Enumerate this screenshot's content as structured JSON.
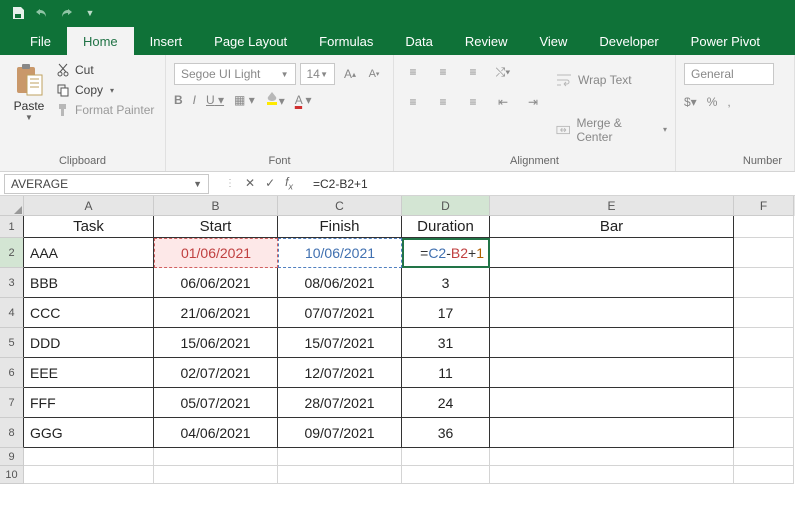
{
  "qat": {
    "save": "save",
    "undo": "undo",
    "redo": "redo"
  },
  "tabs": [
    "File",
    "Home",
    "Insert",
    "Page Layout",
    "Formulas",
    "Data",
    "Review",
    "View",
    "Developer",
    "Power Pivot"
  ],
  "active_tab": 1,
  "clipboard": {
    "paste": "Paste",
    "cut": "Cut",
    "copy": "Copy",
    "format_painter": "Format Painter",
    "label": "Clipboard"
  },
  "font": {
    "name": "Segoe UI Light",
    "size": "14",
    "label": "Font",
    "bold": "B",
    "italic": "I",
    "underline": "U"
  },
  "alignment": {
    "wrap": "Wrap Text",
    "merge": "Merge & Center",
    "label": "Alignment"
  },
  "number": {
    "format": "General",
    "label": "Number"
  },
  "namebox": "AVERAGE",
  "formula": "=C2-B2+1",
  "formula_tokens": {
    "eq": "=",
    "c2": "C2",
    "minus": "-",
    "b2": "B2",
    "plus": "+",
    "one": "1"
  },
  "columns": [
    "A",
    "B",
    "C",
    "D",
    "E",
    "F"
  ],
  "headers": {
    "A": "Task",
    "B": "Start",
    "C": "Finish",
    "D": "Duration",
    "E": "Bar"
  },
  "chart_data": {
    "type": "table",
    "columns": [
      "Task",
      "Start",
      "Finish",
      "Duration",
      "Bar"
    ],
    "rows": [
      {
        "Task": "AAA",
        "Start": "01/06/2021",
        "Finish": "10/06/2021",
        "Duration": "=C2-B2+1",
        "Bar": ""
      },
      {
        "Task": "BBB",
        "Start": "06/06/2021",
        "Finish": "08/06/2021",
        "Duration": "3",
        "Bar": ""
      },
      {
        "Task": "CCC",
        "Start": "21/06/2021",
        "Finish": "07/07/2021",
        "Duration": "17",
        "Bar": ""
      },
      {
        "Task": "DDD",
        "Start": "15/06/2021",
        "Finish": "15/07/2021",
        "Duration": "31",
        "Bar": ""
      },
      {
        "Task": "EEE",
        "Start": "02/07/2021",
        "Finish": "12/07/2021",
        "Duration": "11",
        "Bar": ""
      },
      {
        "Task": "FFF",
        "Start": "05/07/2021",
        "Finish": "28/07/2021",
        "Duration": "24",
        "Bar": ""
      },
      {
        "Task": "GGG",
        "Start": "04/06/2021",
        "Finish": "09/07/2021",
        "Duration": "36",
        "Bar": ""
      }
    ]
  }
}
